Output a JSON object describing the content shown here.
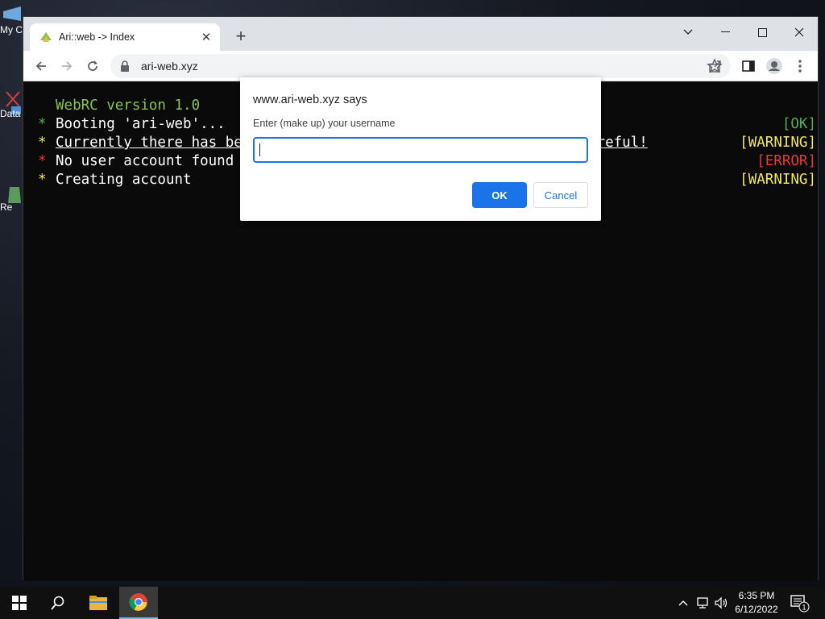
{
  "desktop": {
    "icons": [
      {
        "label": "My C"
      },
      {
        "label": "Data"
      },
      {
        "label": "Re"
      }
    ]
  },
  "browser": {
    "tab": {
      "title": "Ari::web -> Index",
      "close_icon": "close-icon"
    },
    "new_tab_label": "+",
    "url": "ari-web.xyz"
  },
  "terminal": {
    "header": "WebRC version 1.0",
    "lines": [
      {
        "bullet": "*",
        "bullet_color": "#4caf50",
        "text": "Booting 'ari-web'...",
        "status": "[OK]",
        "status_color": "#4caf50"
      },
      {
        "bullet": "*",
        "bullet_color": "#f2e94e",
        "text_left": "Currently there has be",
        "text_right": "areful!",
        "status": "[WARNING]",
        "status_color": "#f2e94e"
      },
      {
        "bullet": "*",
        "bullet_color": "#e53935",
        "text": "No user account found",
        "status": "[ERROR]",
        "status_color": "#e53935"
      },
      {
        "bullet": "*",
        "bullet_color": "#f2e94e",
        "text": "Creating account",
        "status": "[WARNING]",
        "status_color": "#f2e94e"
      }
    ],
    "header_color": "#8bc34a"
  },
  "dialog": {
    "title": "www.ari-web.xyz says",
    "message": "Enter (make up) your username",
    "input_value": "",
    "ok_label": "OK",
    "cancel_label": "Cancel"
  },
  "taskbar": {
    "clock_time": "6:35 PM",
    "clock_date": "6/12/2022",
    "notification_count": "1"
  }
}
